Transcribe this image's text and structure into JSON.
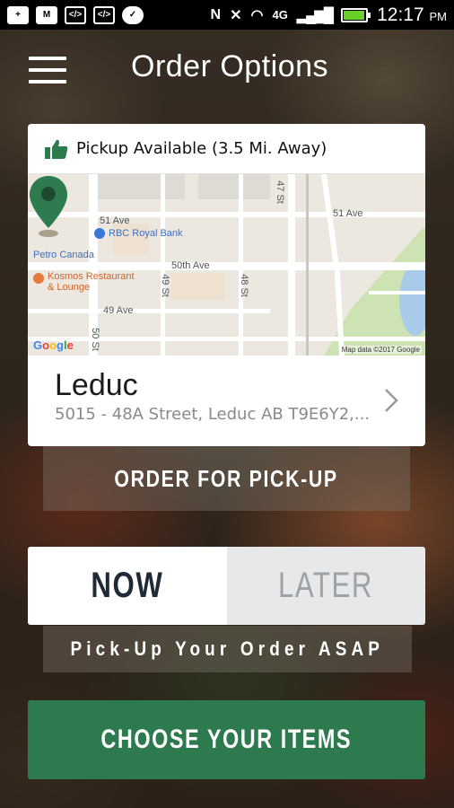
{
  "status_bar": {
    "time": "12:17",
    "ampm": "PM",
    "network": "4G",
    "network_sub": "LTE",
    "battery_color": "#6cd02a",
    "icons": [
      "add-icon",
      "gmail-icon",
      "code-icon",
      "code-icon",
      "messenger-icon",
      "nfc-icon",
      "mute-icon",
      "wifi-icon",
      "signal-icon",
      "battery-icon"
    ]
  },
  "header": {
    "title": "Order Options",
    "menu_icon": "hamburger-menu-icon"
  },
  "store_card": {
    "pickup_text": "Pickup Available (3.5 Mi. Away)",
    "pickup_icon": "thumbs-up-icon",
    "store_name": "Leduc",
    "store_address": "5015 - 48A Street, Leduc AB T9E6Y2,...",
    "map": {
      "labels": {
        "street_51_ave_left": "51 Ave",
        "street_51_ave_right": "51 Ave",
        "street_50th_ave": "50th Ave",
        "street_49_ave": "49 Ave",
        "street_47_st": "47 St",
        "street_49_st": "49 St",
        "street_48_st": "48 St",
        "street_50_st": "50 St"
      },
      "pois": {
        "bank": "RBC Royal Bank",
        "gas": "Petro Canada",
        "restaurant": "Kosmos Restaurant\n& Lounge"
      },
      "google": "Google",
      "credit": "Map data ©2017 Google"
    }
  },
  "order_for_pickup": "ORDER FOR PICK-UP",
  "timing": {
    "now": "NOW",
    "later": "LATER",
    "selected": "now",
    "note": "Pick-Up Your Order ASAP"
  },
  "cta": "CHOOSE YOUR ITEMS",
  "colors": {
    "primary_green": "#2c7a4e",
    "pin_green": "#2e7b50"
  }
}
